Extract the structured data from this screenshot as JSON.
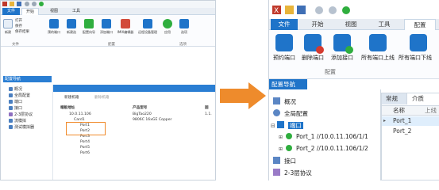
{
  "left": {
    "tabs": [
      "文件",
      "开始",
      "视图",
      "工具"
    ],
    "ribbon": {
      "file_items": [
        "打开",
        "保存",
        "保存结果"
      ],
      "new_label": "新建",
      "buttons": [
        "预的端口",
        "新建选",
        "配置向导",
        "添加端口",
        "IMIX编辑器",
        "远程设备管理",
        "应用",
        "选项"
      ],
      "group_file": "文件",
      "group_config": "配置",
      "group_options": "选项"
    },
    "nav": {
      "header": "配置导航",
      "items": [
        "概况",
        "全局配置",
        "端口",
        "接口",
        "2-3层协议",
        "流模拟",
        "测试模拟器"
      ]
    },
    "panel": {
      "toolbar": [
        "新建机箱",
        "删除机箱"
      ],
      "columns": [
        "端板地址",
        "产品型号",
        "固"
      ],
      "rows": [
        {
          "addr": "10.0.11.106",
          "model": "BigTao220",
          "fw": "1.1."
        },
        {
          "addr": "Card1",
          "model": "9806C 16xGE Copper",
          "fw": ""
        },
        {
          "addr": "Port1",
          "model": "",
          "fw": ""
        },
        {
          "addr": "Port2",
          "model": "",
          "fw": ""
        },
        {
          "addr": "Port3",
          "model": "",
          "fw": ""
        },
        {
          "addr": "Port4",
          "model": "",
          "fw": ""
        },
        {
          "addr": "Port5",
          "model": "",
          "fw": ""
        },
        {
          "addr": "Port6",
          "model": "",
          "fw": ""
        }
      ]
    }
  },
  "right": {
    "tabs": [
      "文件",
      "开始",
      "视图",
      "工具",
      "配置"
    ],
    "ribbon": {
      "buttons": [
        "预约端口",
        "删除端口",
        "添加接口",
        "所有端口上线",
        "所有端口下线"
      ],
      "group": "配置"
    },
    "nav": {
      "header": "配置导航",
      "items": [
        "概况",
        "全局配置",
        "端口",
        "Port_1 //10.0.11.106/1/1",
        "Port_2 //10.0.11.106/1/2",
        "接口",
        "2-3层协议"
      ]
    },
    "grid": {
      "tabs": [
        "常规",
        "介质"
      ],
      "columns": [
        "名称",
        "上线"
      ],
      "rows": [
        "Port_1",
        "Port_2"
      ]
    }
  },
  "colors": {
    "accent": "#1f74c9",
    "arrow": "#ee8b2c",
    "highlight": "#f08a2a",
    "port_green": "#2fae3e"
  }
}
